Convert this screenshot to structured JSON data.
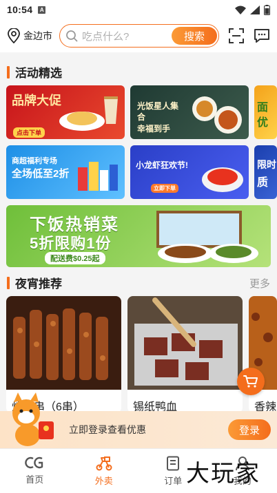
{
  "status_bar": {
    "time": "10:54",
    "sim_label": "A"
  },
  "header": {
    "location": "金边市",
    "search_placeholder": "吃点什么?",
    "search_button": "搜索"
  },
  "sections": {
    "activities": {
      "title": "活动精选"
    },
    "late_night": {
      "title": "夜宵推荐",
      "more": "更多"
    }
  },
  "banners": [
    {
      "line1": "品牌大促",
      "line2": "点击下单",
      "colors": [
        "#c7141b",
        "#e33a2c"
      ]
    },
    {
      "line1": "光饭星人集合",
      "line2": "幸福到手",
      "colors": [
        "#1f3a33",
        "#3b5a4a"
      ]
    },
    {
      "line1": "面",
      "line2": "优",
      "colors": [
        "#f4a21a",
        "#ffd24a"
      ]
    },
    {
      "line1": "商超福利专场",
      "line2": "全场低至2折",
      "colors": [
        "#1e8fe6",
        "#5fc0ff"
      ]
    },
    {
      "line1": "小龙虾狂欢节!",
      "line2": "立即下单",
      "colors": [
        "#2a3fc7",
        "#4a5ef0"
      ]
    },
    {
      "line1": "限时",
      "line2": "质",
      "colors": [
        "#1b3fae",
        "#3a63d4"
      ]
    },
    {
      "line1": "下饭热销菜",
      "line2": "5折限购1份",
      "line3": "配送费$0.25起",
      "colors": [
        "#6fbf3a",
        "#a6dd6a"
      ]
    }
  ],
  "foods": [
    {
      "name": "烤肉串（6串）"
    },
    {
      "name": "锡纸鸭血"
    },
    {
      "name": "香辣"
    }
  ],
  "login_bar": {
    "message": "立即登录查看优惠",
    "button": "登录"
  },
  "tabs": [
    {
      "label": "首页",
      "icon": "home-icon"
    },
    {
      "label": "外卖",
      "icon": "delivery-icon",
      "active": true
    },
    {
      "label": "订单",
      "icon": "order-icon"
    },
    {
      "label": "我的",
      "icon": "profile-icon"
    }
  ],
  "watermark": "大玩家",
  "colors": {
    "accent": "#f46d1c",
    "accent_light": "#fb9a36"
  }
}
